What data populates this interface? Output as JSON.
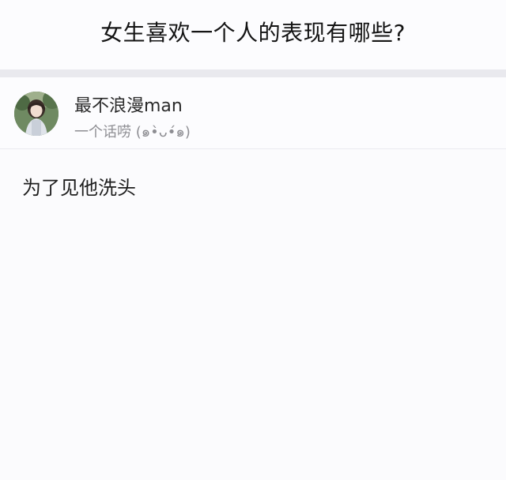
{
  "question": {
    "title": "女生喜欢一个人的表现有哪些?"
  },
  "author": {
    "name": "最不浪漫man",
    "bio": "一个话唠 (๑•̀ᴗ•́๑)",
    "avatar_icon": "avatar-photo"
  },
  "answer": {
    "text": "为了见他洗头"
  }
}
